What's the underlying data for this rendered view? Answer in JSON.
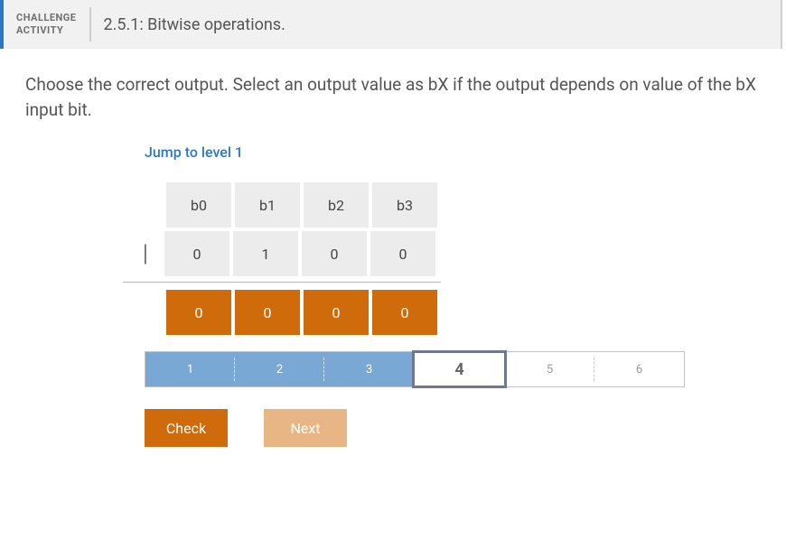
{
  "header": {
    "label_line1": "CHALLENGE",
    "label_line2": "ACTIVITY",
    "title": "2.5.1: Bitwise operations."
  },
  "instruction": "Choose the correct output. Select an output value as bX if the output depends on value of the bX input bit.",
  "jump_link": "Jump to level 1",
  "bits": {
    "headers": [
      "b0",
      "b1",
      "b2",
      "b3"
    ],
    "operator": "|",
    "row": [
      "0",
      "1",
      "0",
      "0"
    ],
    "output": [
      "0",
      "0",
      "0",
      "0"
    ]
  },
  "levels": {
    "items": [
      "1",
      "2",
      "3",
      "4",
      "5",
      "6"
    ],
    "done_upto": 3,
    "current": 4
  },
  "buttons": {
    "check": "Check",
    "next": "Next"
  }
}
